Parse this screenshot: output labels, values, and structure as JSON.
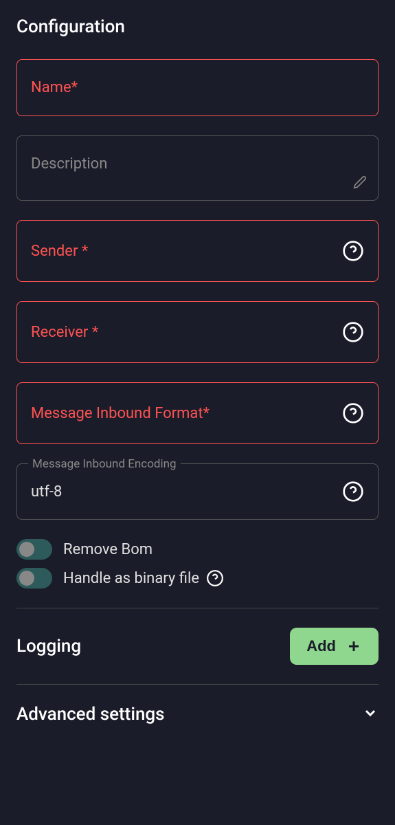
{
  "configuration": {
    "title": "Configuration",
    "fields": {
      "name": {
        "label": "Name*"
      },
      "description": {
        "label": "Description"
      },
      "sender": {
        "label": "Sender *"
      },
      "receiver": {
        "label": "Receiver *"
      },
      "inbound_format": {
        "label": "Message Inbound Format*"
      },
      "inbound_encoding": {
        "legend": "Message Inbound Encoding",
        "value": "utf-8"
      }
    },
    "toggles": {
      "remove_bom": {
        "label": "Remove Bom",
        "checked": false
      },
      "handle_binary": {
        "label": "Handle as binary file",
        "checked": false
      }
    }
  },
  "logging": {
    "title": "Logging",
    "add_label": "Add"
  },
  "advanced": {
    "title": "Advanced settings"
  }
}
